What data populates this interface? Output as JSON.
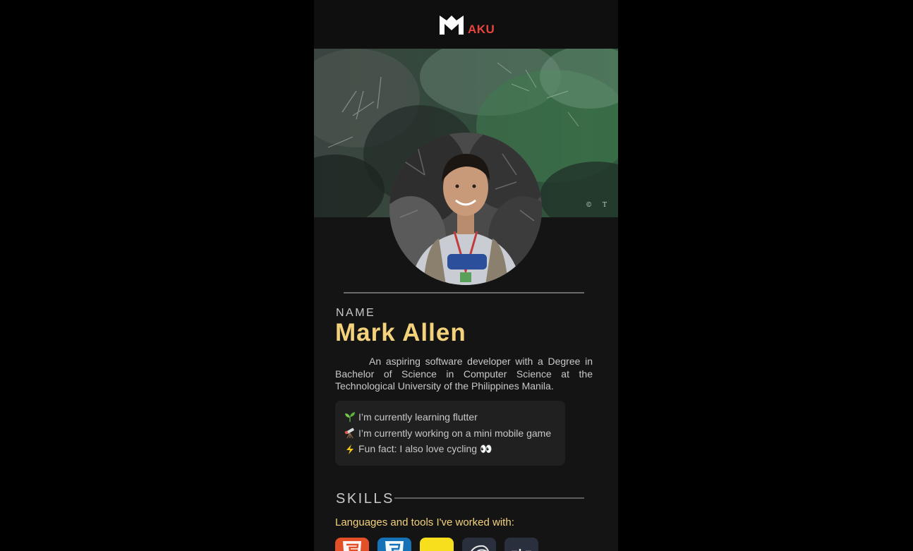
{
  "header": {
    "logo_text": "AKU"
  },
  "cover": {
    "credit": "© T"
  },
  "profile": {
    "name_label": "NAME",
    "name": "Mark Allen",
    "bio": "An aspiring software developer with a Degree in Bachelor of Science in Computer Science at the Technological University of the Philippines Manila."
  },
  "facts": [
    {
      "icon": "seedling-icon",
      "text": "I’m currently learning flutter"
    },
    {
      "icon": "telescope-icon",
      "text": "I’m currently working on a mini mobile game"
    },
    {
      "icon": "lightning-icon",
      "text": "Fun fact: I also love cycling 👀"
    }
  ],
  "skills": {
    "title": "SKILLS",
    "subtitle": "Languages and tools I've worked with:",
    "tools": [
      {
        "icon": "html5-icon",
        "color": "#e34f26"
      },
      {
        "icon": "css3-icon",
        "color": "#1572b6"
      },
      {
        "icon": "javascript-icon",
        "color": "#f7df1e"
      },
      {
        "icon": "mysql-icon",
        "color": "#2a2f3d"
      },
      {
        "icon": "php-icon",
        "color": "#2a2f3d"
      }
    ]
  },
  "colors": {
    "accent": "#f4d27c",
    "logo_red": "#e8453c",
    "background": "#141414"
  }
}
